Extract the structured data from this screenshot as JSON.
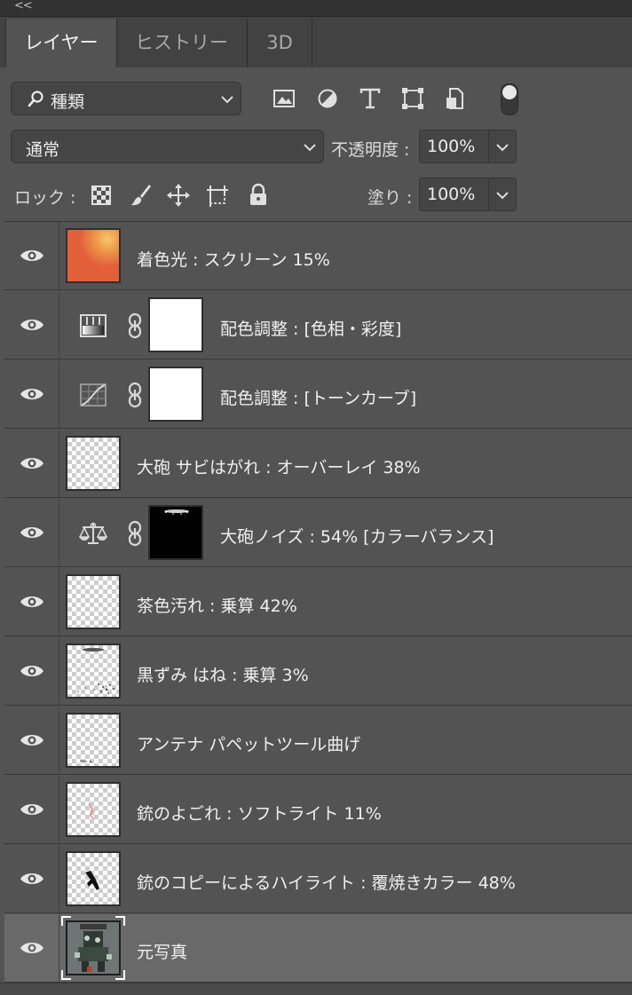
{
  "panel": {
    "collapse_glyph": "<<"
  },
  "tabs": [
    {
      "label": "レイヤー",
      "active": true
    },
    {
      "label": "ヒストリー",
      "active": false
    },
    {
      "label": "3D",
      "active": false
    }
  ],
  "filter": {
    "kind_label": "種類",
    "icons": [
      "image-filter-icon",
      "adjustment-filter-icon",
      "type-filter-icon",
      "shape-filter-icon",
      "smart-object-filter-icon"
    ]
  },
  "blend": {
    "mode": "通常",
    "opacity_label": "不透明度 :",
    "opacity_value": "100%"
  },
  "lock": {
    "label": "ロック :",
    "fill_label": "塗り :",
    "fill_value": "100%"
  },
  "colors": {
    "panel_bg": "#535353",
    "selected_row": "#696969",
    "orange_fill": "#e25f3a"
  },
  "layers": [
    {
      "name": "着色光 : スクリーン  15%",
      "type": "orange-fill"
    },
    {
      "name": "配色調整 : [色相・彩度]",
      "type": "adjust-hue"
    },
    {
      "name": "配色調整 : [トーンカーブ]",
      "type": "adjust-curves"
    },
    {
      "name": "大砲 サビはがれ : オーバーレイ 38%",
      "type": "transparent"
    },
    {
      "name": "大砲ノイズ  : 54% [カラーバランス]",
      "type": "adjust-balance"
    },
    {
      "name": "茶色汚れ : 乗算 42%",
      "type": "transparent"
    },
    {
      "name": "黒ずみ はね : 乗算 3%",
      "type": "transparent-speckle"
    },
    {
      "name": "アンテナ パペットツール曲げ",
      "type": "transparent"
    },
    {
      "name": "銃のよごれ : ソフトライト 11%",
      "type": "transparent"
    },
    {
      "name": "銃のコピーによるハイライト : 覆焼きカラー 48%",
      "type": "transparent-gun"
    },
    {
      "name": "元写真",
      "type": "photo",
      "selected": true
    }
  ]
}
